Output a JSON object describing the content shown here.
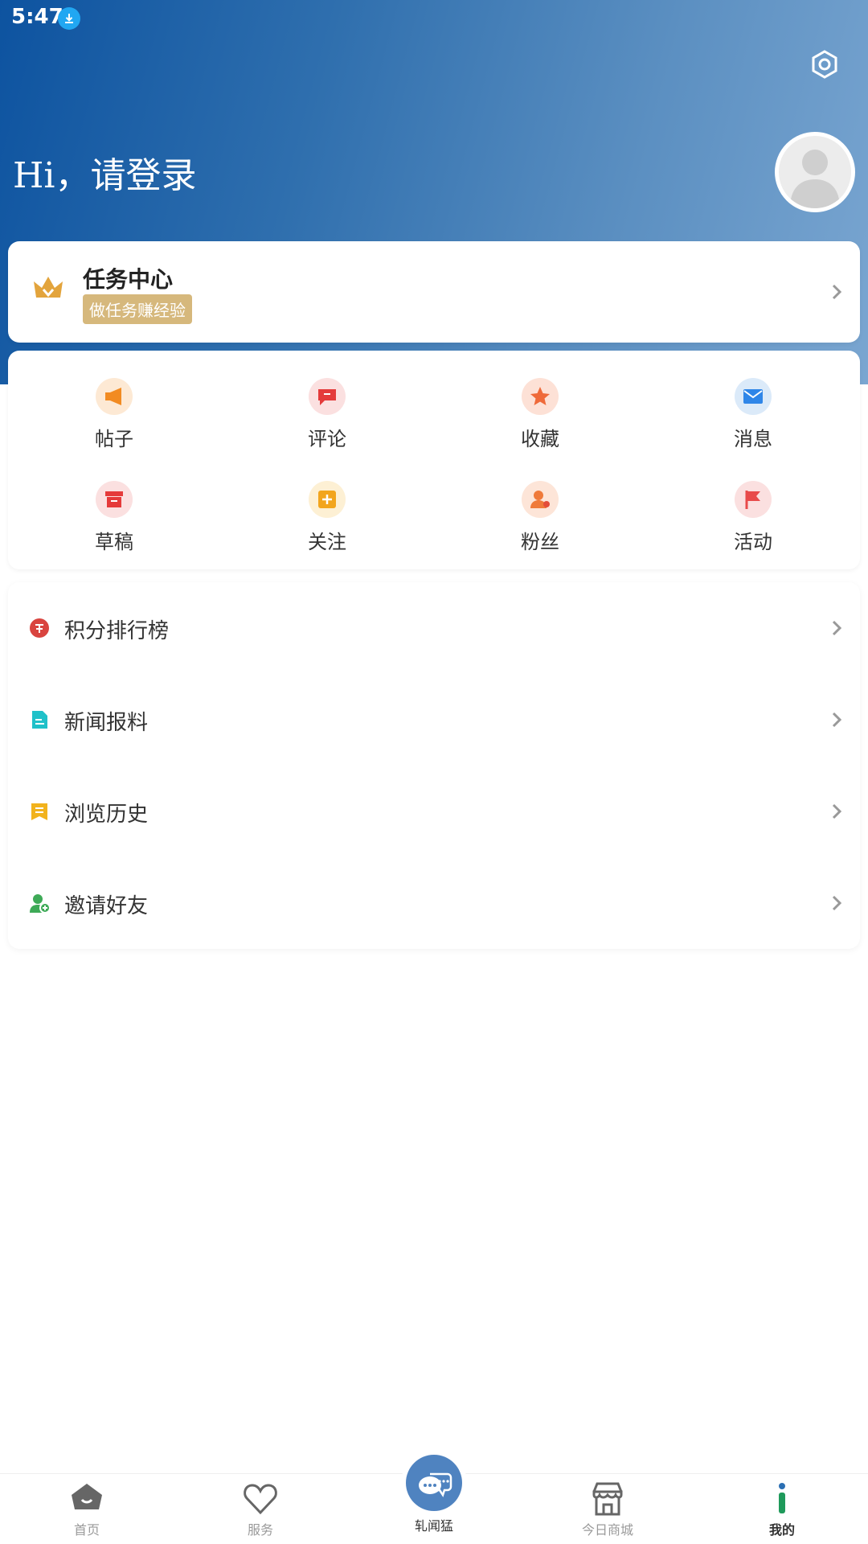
{
  "status_bar": {
    "time": "5:47",
    "download_icon": "download-icon"
  },
  "header": {
    "greeting": "Hi，请登录",
    "settings_icon": "gear-icon",
    "avatar_icon": "avatar-icon"
  },
  "task_card": {
    "title": "任务中心",
    "badge": "做任务赚经验",
    "icon": "crown-icon"
  },
  "grid": [
    {
      "label": "帖子",
      "icon": "megaphone-icon",
      "color": "#f28b22"
    },
    {
      "label": "评论",
      "icon": "comment-icon",
      "color": "#e43b3b"
    },
    {
      "label": "收藏",
      "icon": "star-icon",
      "color": "#ef6a3a"
    },
    {
      "label": "消息",
      "icon": "mail-icon",
      "color": "#2f86e8"
    },
    {
      "label": "草稿",
      "icon": "archive-icon",
      "color": "#e53a3a"
    },
    {
      "label": "关注",
      "icon": "plus-icon",
      "color": "#f2a51d"
    },
    {
      "label": "粉丝",
      "icon": "fan-icon",
      "color": "#ef7a3a"
    },
    {
      "label": "活动",
      "icon": "flag-icon",
      "color": "#e84b4b"
    }
  ],
  "list": [
    {
      "label": "积分排行榜",
      "icon": "points-icon",
      "color": "#d9443f"
    },
    {
      "label": "新闻报料",
      "icon": "document-icon",
      "color": "#20c1c9"
    },
    {
      "label": "浏览历史",
      "icon": "history-icon",
      "color": "#f2b31d"
    },
    {
      "label": "邀请好友",
      "icon": "invite-friend-icon",
      "color": "#3eaa57"
    }
  ],
  "bottom_nav": {
    "items": [
      {
        "label": "首页",
        "icon": "home-icon"
      },
      {
        "label": "服务",
        "icon": "heart-icon"
      },
      {
        "label": "今日商城",
        "icon": "store-icon"
      },
      {
        "label": "我的",
        "icon": "profile-icon"
      }
    ],
    "center": {
      "label": "轧闻猛",
      "icon": "chat-bubble-icon"
    }
  },
  "colors": {
    "header_start": "#0d53a0",
    "header_end": "#7aa6d1",
    "badge": "#d6b87c",
    "fab": "#4f83c0"
  }
}
